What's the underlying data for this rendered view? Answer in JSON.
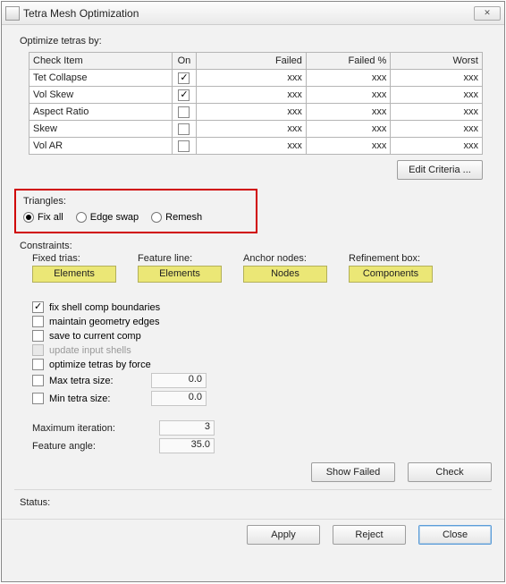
{
  "window": {
    "title": "Tetra Mesh Optimization",
    "close_glyph": "✕"
  },
  "optimize_label": "Optimize tetras by:",
  "table": {
    "headers": {
      "item": "Check Item",
      "on": "On",
      "failed": "Failed",
      "failedp": "Failed %",
      "worst": "Worst"
    },
    "rows": [
      {
        "name": "Tet Collapse",
        "on": true,
        "failed": "xxx",
        "failedp": "xxx",
        "worst": "xxx"
      },
      {
        "name": "Vol Skew",
        "on": true,
        "failed": "xxx",
        "failedp": "xxx",
        "worst": "xxx"
      },
      {
        "name": "Aspect Ratio",
        "on": false,
        "failed": "xxx",
        "failedp": "xxx",
        "worst": "xxx"
      },
      {
        "name": "Skew",
        "on": false,
        "failed": "xxx",
        "failedp": "xxx",
        "worst": "xxx"
      },
      {
        "name": "Vol AR",
        "on": false,
        "failed": "xxx",
        "failedp": "xxx",
        "worst": "xxx"
      }
    ]
  },
  "edit_criteria_label": "Edit Criteria ...",
  "triangles": {
    "label": "Triangles:",
    "options": {
      "fixall": "Fix all",
      "edgeswap": "Edge swap",
      "remesh": "Remesh"
    },
    "selected": "fixall"
  },
  "constraints": {
    "label": "Constraints:",
    "fixed_trias_label": "Fixed trias:",
    "feature_line_label": "Feature line:",
    "anchor_nodes_label": "Anchor nodes:",
    "refinement_box_label": "Refinement box:",
    "elements_label": "Elements",
    "nodes_label": "Nodes",
    "components_label": "Components"
  },
  "options": {
    "fix_shell_comp": {
      "label": "fix shell comp boundaries",
      "checked": true
    },
    "maintain_geom": {
      "label": "maintain geometry edges",
      "checked": false
    },
    "save_current": {
      "label": "save to current comp",
      "checked": false
    },
    "update_input": {
      "label": "update input shells",
      "checked": false,
      "enabled": false
    },
    "optimize_force": {
      "label": "optimize tetras by force",
      "checked": false
    },
    "max_tetra": {
      "label": "Max tetra size:",
      "checked": false,
      "value": "0.0"
    },
    "min_tetra": {
      "label": "Min tetra size:",
      "checked": false,
      "value": "0.0"
    },
    "max_iter": {
      "label": "Maximum iteration:",
      "value": "3"
    },
    "feature_angle": {
      "label": "Feature angle:",
      "value": "35.0"
    }
  },
  "buttons": {
    "show_failed": "Show Failed",
    "check": "Check",
    "apply": "Apply",
    "reject": "Reject",
    "close": "Close"
  },
  "status_label": "Status:"
}
